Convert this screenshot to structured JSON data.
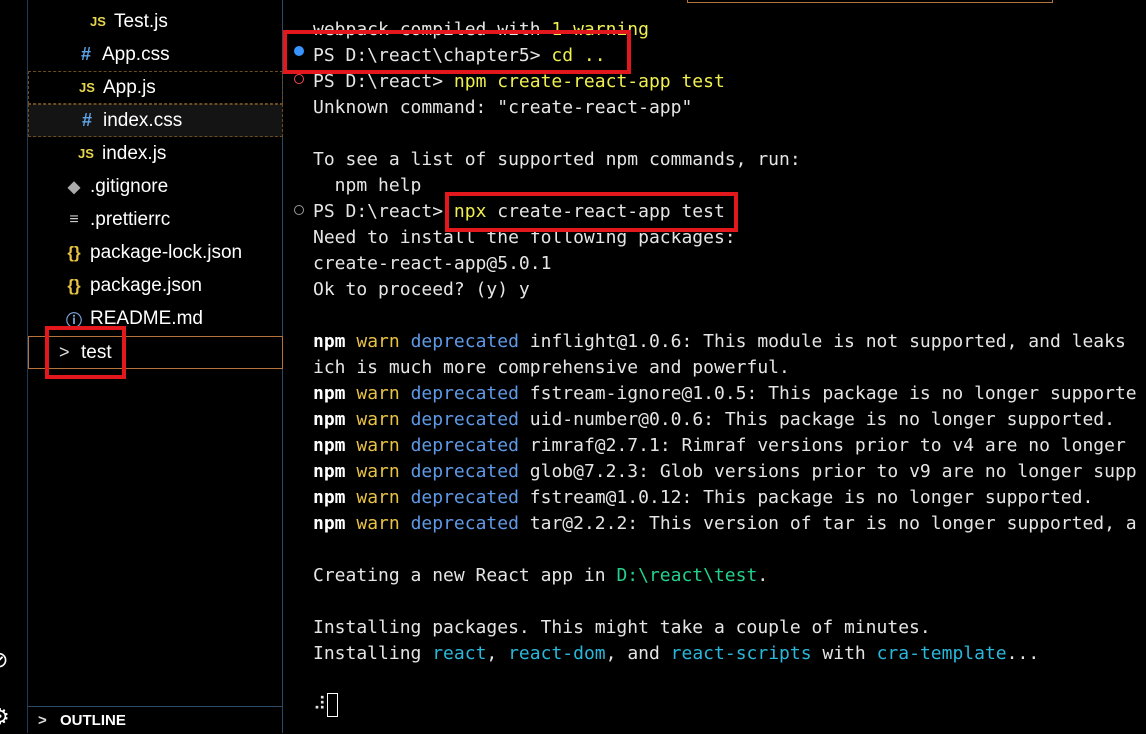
{
  "explorer": {
    "items": [
      {
        "icon": "JS",
        "label": "Test.js"
      },
      {
        "icon": "#",
        "label": "App.css"
      },
      {
        "icon": "JS",
        "label": "App.js"
      },
      {
        "icon": "#",
        "label": "index.css"
      },
      {
        "icon": "JS",
        "label": "index.js"
      },
      {
        "icon": "◆",
        "label": ".gitignore"
      },
      {
        "icon": "≡",
        "label": ".prettierrc"
      },
      {
        "icon": "{}",
        "label": "package-lock.json"
      },
      {
        "icon": "{}",
        "label": "package.json"
      },
      {
        "icon": "ⓘ",
        "label": "README.md"
      },
      {
        "icon": ">",
        "label": "test"
      }
    ],
    "outline_label": "OUTLINE"
  },
  "terminal": {
    "l0a": "webpack compiled with ",
    "l0b": "1 warning",
    "l1a": "PS D:\\react\\chapter5> ",
    "l1b": "cd ..",
    "l2a": "PS D:\\react> ",
    "l2b": "npm create-react-app test",
    "l3": "Unknown command: \"create-react-app\"",
    "l4": "To see a list of supported npm commands, run:",
    "l5": "  npm help",
    "l6a": "PS D:\\react> ",
    "l6b": "npx",
    "l6c": " create-react-app test",
    "l7": "Need to install the following packages:",
    "l8": "create-react-app@5.0.1",
    "l9": "Ok to proceed? (y) y",
    "npm": "npm",
    "warn": "warn",
    "dep": "deprecated",
    "w1": " inflight@1.0.6: This module is not supported, and leaks",
    "w1b": "ich is much more comprehensive and powerful.",
    "w2": " fstream-ignore@1.0.5: This package is no longer supporte",
    "w3": " uid-number@0.0.6: This package is no longer supported.",
    "w4": " rimraf@2.7.1: Rimraf versions prior to v4 are no longer",
    "w5": " glob@7.2.3: Glob versions prior to v9 are no longer supp",
    "w6": " fstream@1.0.12: This package is no longer supported.",
    "w7": " tar@2.2.2: This version of tar is no longer supported, a",
    "c1a": "Creating a new React app in ",
    "c1b": "D:\\react\\test",
    "c1c": ".",
    "i1": "Installing packages. This might take a couple of minutes.",
    "i2a": "Installing ",
    "i2b": "react",
    "i2c": ", ",
    "i2d": "react-dom",
    "i2e": ", and ",
    "i2f": "react-scripts",
    "i2g": " with ",
    "i2h": "cra-template",
    "i2i": "...",
    "spinner": "⠼"
  }
}
